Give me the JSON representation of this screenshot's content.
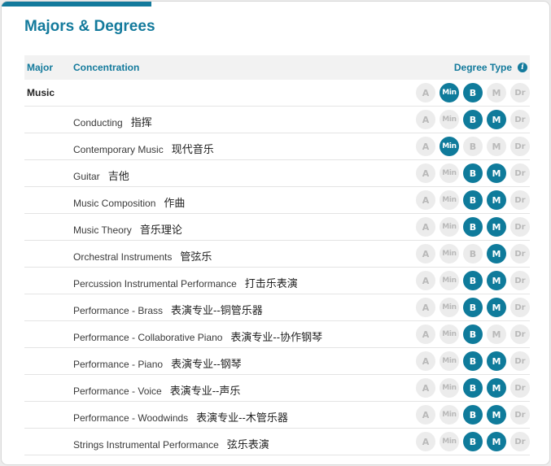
{
  "title": "Majors & Degrees",
  "header": {
    "major": "Major",
    "concentration": "Concentration",
    "degree_type": "Degree Type",
    "info_icon": "info-icon"
  },
  "degree_labels": [
    "A",
    "Min",
    "B",
    "M",
    "Dr"
  ],
  "colors": {
    "accent": "#137a9c",
    "active": "#0f7b9b",
    "inactive": "#ececec"
  },
  "major": {
    "name": "Music",
    "degrees": [
      false,
      true,
      true,
      false,
      false
    ]
  },
  "concentrations": [
    {
      "en": "Conducting",
      "zh": "指挥",
      "degrees": [
        false,
        false,
        true,
        true,
        false
      ]
    },
    {
      "en": "Contemporary Music",
      "zh": "现代音乐",
      "degrees": [
        false,
        true,
        false,
        false,
        false
      ]
    },
    {
      "en": "Guitar",
      "zh": "吉他",
      "degrees": [
        false,
        false,
        true,
        true,
        false
      ]
    },
    {
      "en": "Music Composition",
      "zh": "作曲",
      "degrees": [
        false,
        false,
        true,
        true,
        false
      ]
    },
    {
      "en": "Music Theory",
      "zh": "音乐理论",
      "degrees": [
        false,
        false,
        true,
        true,
        false
      ]
    },
    {
      "en": "Orchestral Instruments",
      "zh": "管弦乐",
      "degrees": [
        false,
        false,
        false,
        true,
        false
      ]
    },
    {
      "en": "Percussion Instrumental Performance",
      "zh": "打击乐表演",
      "degrees": [
        false,
        false,
        true,
        true,
        false
      ]
    },
    {
      "en": "Performance - Brass",
      "zh": "表演专业--铜管乐器",
      "degrees": [
        false,
        false,
        true,
        true,
        false
      ]
    },
    {
      "en": "Performance - Collaborative Piano",
      "zh": "表演专业--协作钢琴",
      "degrees": [
        false,
        false,
        true,
        false,
        false
      ]
    },
    {
      "en": "Performance - Piano",
      "zh": "表演专业--钢琴",
      "degrees": [
        false,
        false,
        true,
        true,
        false
      ]
    },
    {
      "en": "Performance - Voice",
      "zh": "表演专业--声乐",
      "degrees": [
        false,
        false,
        true,
        true,
        false
      ]
    },
    {
      "en": "Performance - Woodwinds",
      "zh": "表演专业--木管乐器",
      "degrees": [
        false,
        false,
        true,
        true,
        false
      ]
    },
    {
      "en": "Strings Instrumental Performance",
      "zh": "弦乐表演",
      "degrees": [
        false,
        false,
        true,
        true,
        false
      ]
    }
  ]
}
